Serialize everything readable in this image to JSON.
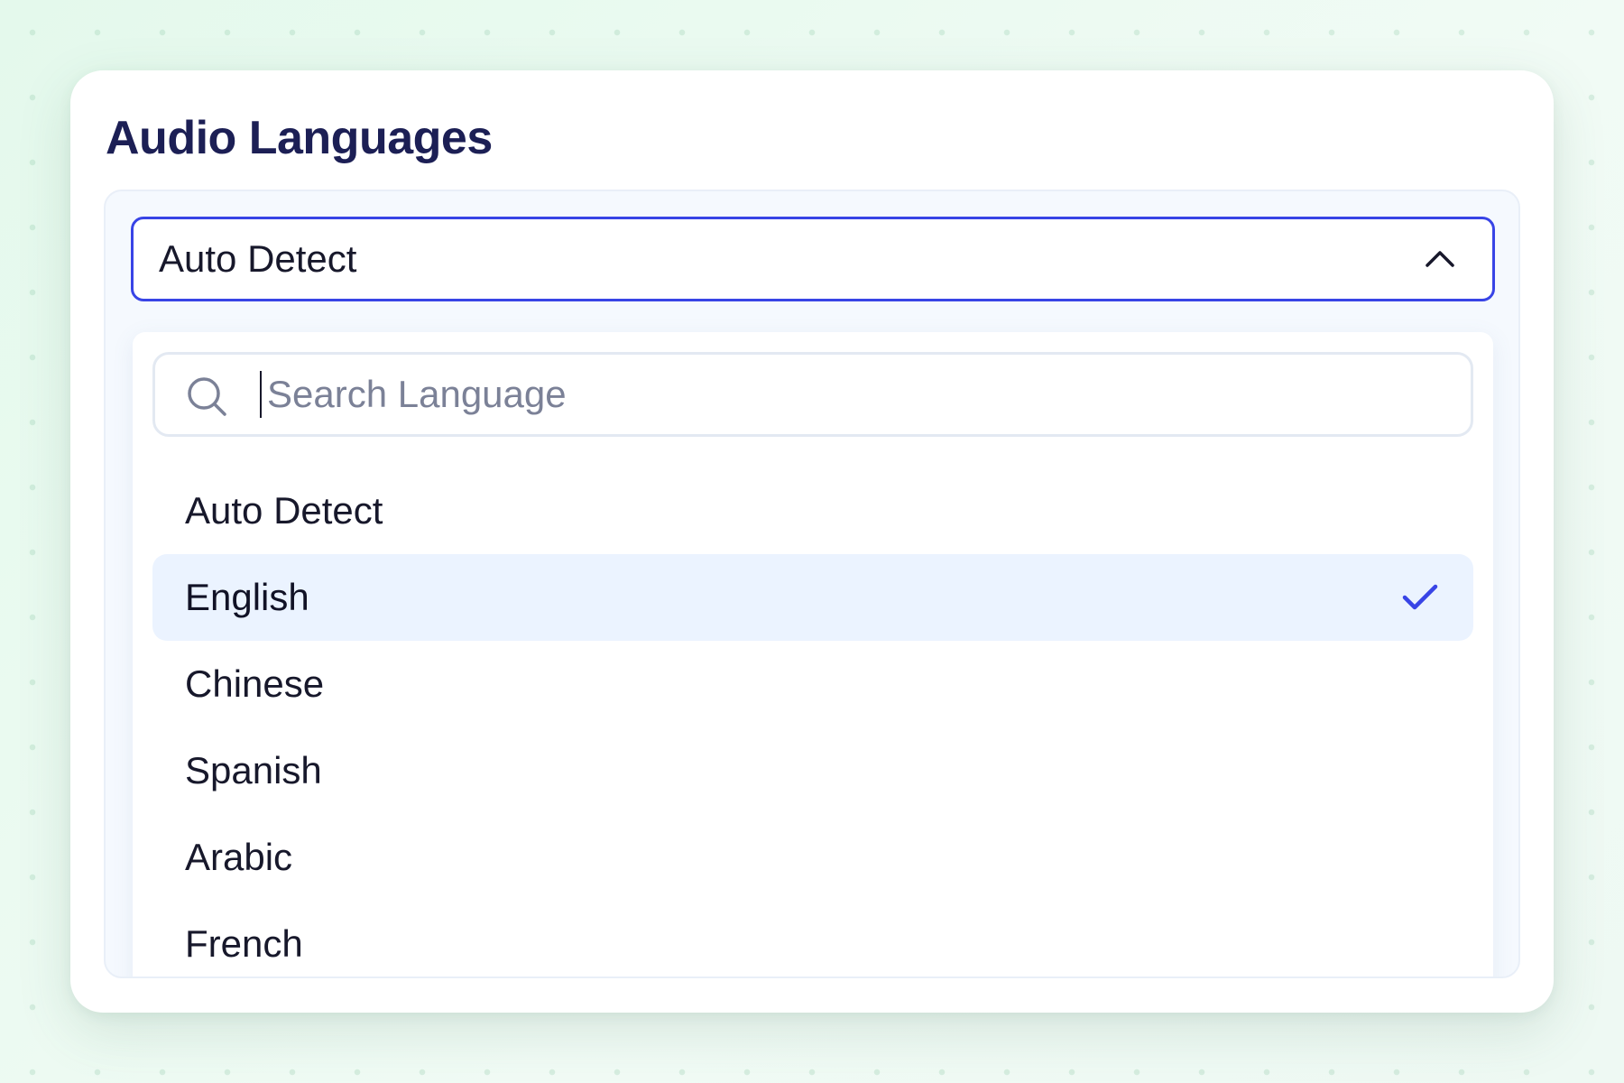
{
  "dialog": {
    "title": "Audio Languages"
  },
  "select": {
    "value": "Auto Detect",
    "expanded": true,
    "chevron_icon": "chevron-up-icon",
    "border_color": "#3844e6"
  },
  "search": {
    "placeholder": "Search Language",
    "value": "",
    "icon": "search-icon"
  },
  "options": [
    {
      "label": "Auto Detect",
      "selected": false
    },
    {
      "label": "English",
      "selected": true,
      "icon": "check-icon"
    },
    {
      "label": "Chinese",
      "selected": false
    },
    {
      "label": "Spanish",
      "selected": false
    },
    {
      "label": "Arabic",
      "selected": false
    },
    {
      "label": "French",
      "selected": false
    }
  ],
  "colors": {
    "accent": "#3844e6",
    "selected_background": "#ebf3ff",
    "title": "#1c1f55",
    "text": "#17182b"
  }
}
